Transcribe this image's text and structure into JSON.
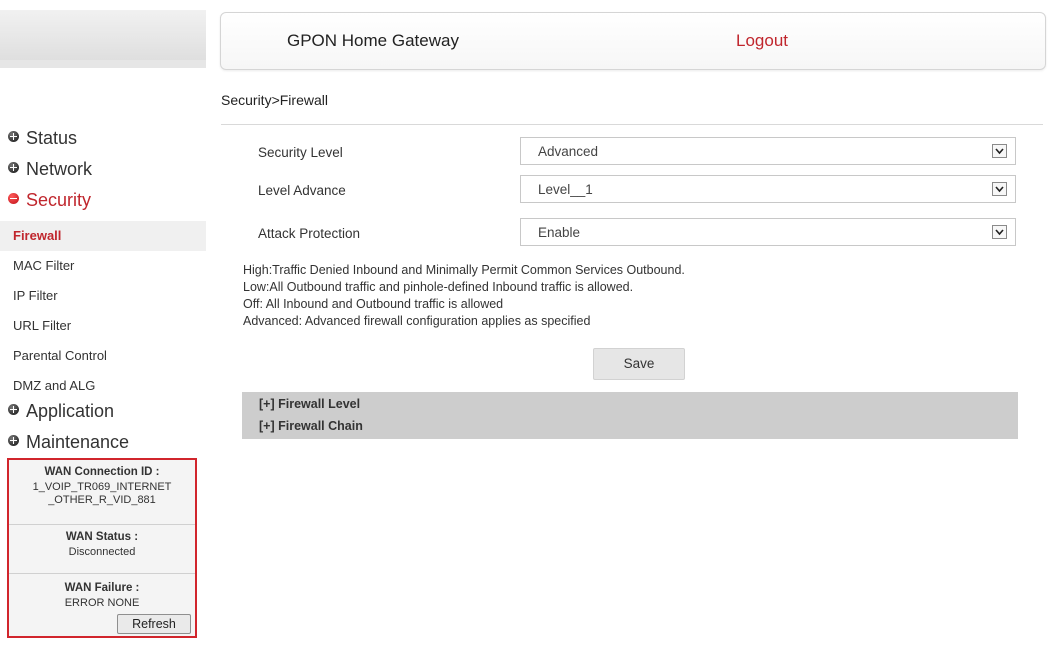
{
  "header": {
    "title": "GPON Home Gateway",
    "logout": "Logout"
  },
  "breadcrumb": "Security>Firewall",
  "sidebar": {
    "menus": [
      {
        "label": "Status",
        "state": "collapsed",
        "icon": "plus-circle-icon"
      },
      {
        "label": "Network",
        "state": "collapsed",
        "icon": "plus-circle-icon"
      },
      {
        "label": "Security",
        "state": "expanded",
        "icon": "minus-circle-icon"
      }
    ],
    "security_items": [
      {
        "label": "Firewall",
        "active": true
      },
      {
        "label": "MAC Filter"
      },
      {
        "label": "IP Filter"
      },
      {
        "label": "URL Filter"
      },
      {
        "label": "Parental Control"
      },
      {
        "label": "DMZ and ALG"
      }
    ],
    "menus_after": [
      {
        "label": "Application",
        "state": "collapsed",
        "icon": "plus-circle-icon"
      },
      {
        "label": "Maintenance",
        "state": "collapsed",
        "icon": "plus-circle-icon"
      }
    ]
  },
  "wan": {
    "connection_id_label": "WAN Connection ID :",
    "connection_id_line1": "1_VOIP_TR069_INTERNET",
    "connection_id_line2": "_OTHER_R_VID_881",
    "status_label": "WAN Status :",
    "status_value": "Disconnected",
    "failure_label": "WAN Failure :",
    "failure_value": "ERROR NONE",
    "refresh": "Refresh"
  },
  "form": {
    "security_level": {
      "label": "Security Level",
      "value": "Advanced"
    },
    "level_advance": {
      "label": "Level Advance",
      "value": "Level__1"
    },
    "attack_protection": {
      "label": "Attack Protection",
      "value": "Enable"
    }
  },
  "descriptions": [
    "High:Traffic Denied Inbound and Minimally Permit Common Services Outbound.",
    "Low:All Outbound traffic and pinhole-defined Inbound traffic is allowed.",
    "Off: All Inbound and Outbound traffic is allowed",
    "Advanced: Advanced firewall configuration applies as specified"
  ],
  "save": "Save",
  "panels": {
    "firewall_level": "[+] Firewall Level",
    "firewall_chain": "[+] Firewall Chain"
  },
  "colors": {
    "accent": "#c0262d",
    "panel_bg": "#cdcdcd",
    "wan_border": "#d1252c"
  }
}
